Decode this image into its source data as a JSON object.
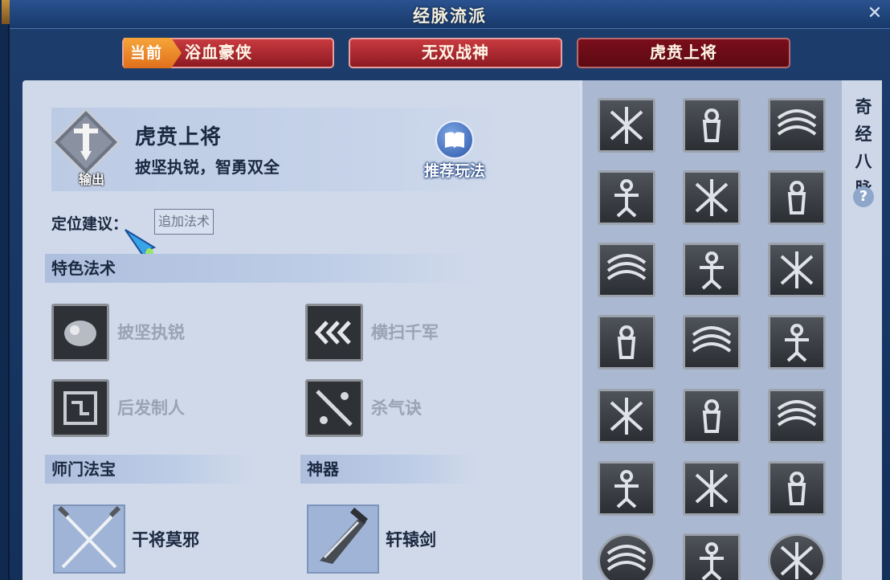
{
  "window": {
    "title": "经脉流派",
    "close_icon": "close-icon"
  },
  "tabs": [
    {
      "label": "浴血豪侠",
      "badge": "当前",
      "state": "current"
    },
    {
      "label": "无双战神",
      "state": "normal"
    },
    {
      "label": "虎贲上将",
      "state": "selected"
    }
  ],
  "school": {
    "role_label": "输出",
    "name": "虎贲上将",
    "motto": "披坚执锐，智勇双全",
    "guide_label": "推荐玩法"
  },
  "positioning": {
    "label": "定位建议：",
    "value": "追加法术"
  },
  "special_skills": {
    "title": "特色法术",
    "items": [
      {
        "name": "披坚执锐",
        "icon": "armor-icon"
      },
      {
        "name": "横扫千军",
        "icon": "sweep-icon"
      },
      {
        "name": "后发制人",
        "icon": "counter-icon"
      },
      {
        "name": "杀气诀",
        "icon": "sword-aura-icon"
      }
    ]
  },
  "sect_treasure": {
    "title": "师门法宝",
    "item_name": "干将莫邪",
    "icon": "crossed-swords-icon"
  },
  "artifact": {
    "title": "神器",
    "item_name": "轩辕剑",
    "icon": "xuanyuan-sword-icon"
  },
  "meridians": {
    "title": "奇经八脉",
    "help_icon": "?",
    "icons": [
      "burst-icon",
      "soldier-icon",
      "whirl-icon",
      "warrior-icon",
      "blade-slash-icon",
      "fan-icon",
      "crescent-slash-icon",
      "broken-heart-icon",
      "lightning-icon",
      "fist-icon",
      "twin-guards-icon",
      "smoke-hand-icon",
      "scatter-blades-icon",
      "running-man-icon",
      "heart-crack-icon",
      "shattered-sword-icon",
      "brave-seal-icon",
      "scroll-icon",
      "swirl-orb-icon",
      "arrows-icon",
      "swirl-orb-icon"
    ]
  }
}
